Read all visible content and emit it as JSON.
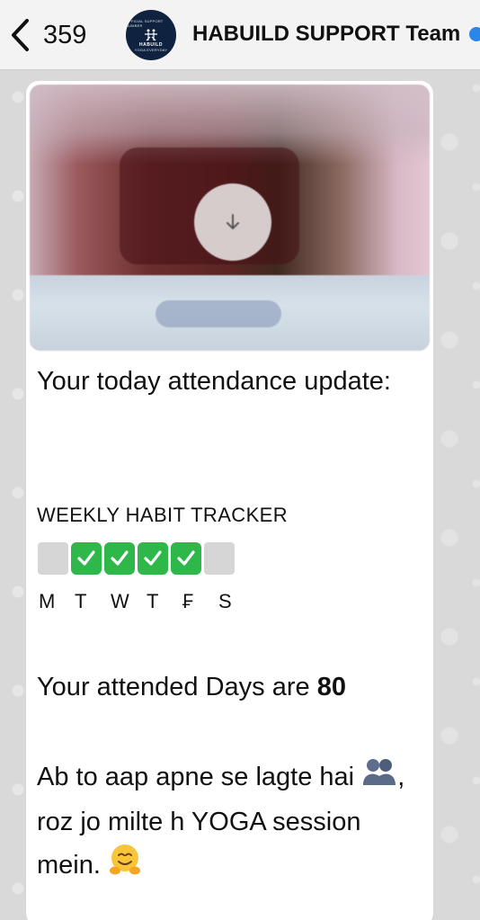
{
  "header": {
    "back_count": "359",
    "team_name": "HABUILD SUPPORT Team",
    "avatar": {
      "top_text": "OFFICIAL SUPPORT NUMBER",
      "brand": "HABUILD",
      "tagline": "YOGA EVERYDAY"
    }
  },
  "message": {
    "media_action_icon": "download-arrow-icon",
    "line1": "Your today attendance update:",
    "tracker_title": "WEEKLY HABIT TRACKER",
    "tracker": [
      {
        "day": "M",
        "status": "empty"
      },
      {
        "day": "T",
        "status": "check"
      },
      {
        "day": "W",
        "status": "check"
      },
      {
        "day": "T",
        "status": "check"
      },
      {
        "day": "F",
        "status": "check"
      },
      {
        "day": "S",
        "status": "empty"
      }
    ],
    "days": [
      "M",
      "T",
      "W",
      "T",
      "₣",
      "S"
    ],
    "attended_prefix": "Your attended Days are ",
    "attended_count": "80",
    "closing_part1": "Ab to aap apne se lagte hai",
    "closing_part2": ", roz jo milte h YOGA session mein.",
    "emoji_1": "people-hugging-emoji",
    "emoji_2": "hugging-face-emoji"
  },
  "colors": {
    "header_bg": "#f3f3f3",
    "bubble_bg": "#ffffff",
    "check_green": "#2fb84a",
    "verified_blue": "#2b86e8"
  }
}
